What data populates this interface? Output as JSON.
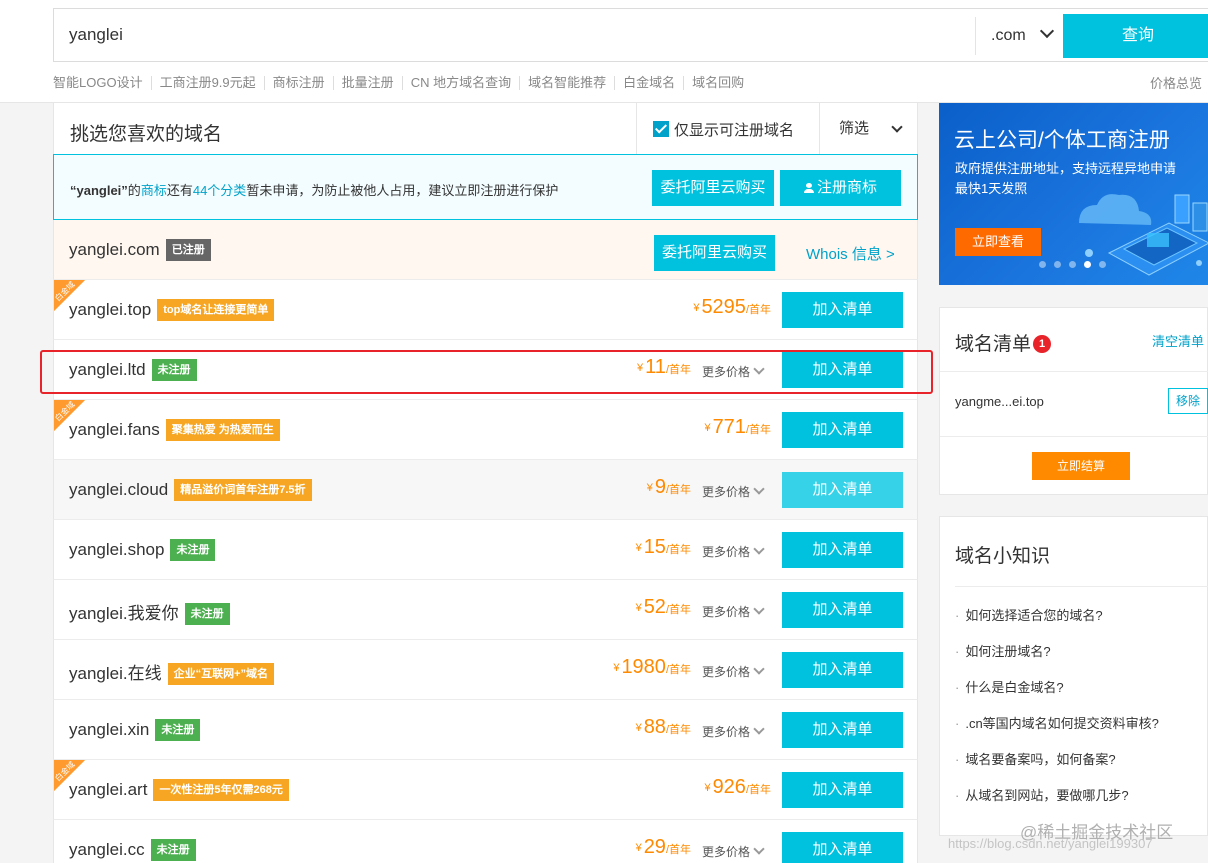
{
  "search": {
    "value": "yanglei",
    "suffix": ".com",
    "query_label": "查询"
  },
  "quick_links": [
    "智能LOGO设计",
    "工商注册9.9元起",
    "商标注册",
    "批量注册",
    "CN 地方域名查询",
    "域名智能推荐",
    "白金域名",
    "域名回购"
  ],
  "price_overview": "价格总览",
  "list": {
    "title": "挑选您喜欢的域名",
    "only_registrable": "仅显示可注册域名",
    "filter": "筛选"
  },
  "trademark": {
    "name": "“yanglei”",
    "t1": "的",
    "link1": "商标",
    "t2": "还有",
    "link2": "44个分类",
    "t3": "暂未申请，为防止被他人占用，建议立即注册进行保护",
    "buy_label": "委托阿里云购买",
    "register_label": "注册商标"
  },
  "registered_row": {
    "domain": "yanglei.com",
    "tag": "已注册",
    "buy_label": "委托阿里云购买",
    "whois_label": "Whois 信息 >"
  },
  "common": {
    "yen": "¥",
    "per_year": "/首年",
    "more_price": "更多价格",
    "add_label": "加入清单",
    "corner_label": "白金域"
  },
  "rows": [
    {
      "domain": "yanglei.top",
      "tag": "top域名让连接更简单",
      "price": "5295"
    },
    {
      "domain": "yanglei.ltd",
      "tag": "未注册",
      "price": "11"
    },
    {
      "domain": "yanglei.fans",
      "tag": "聚集热爱 为热爱而生",
      "price": "771"
    },
    {
      "domain": "yanglei.cloud",
      "tag": "精品溢价词首年注册7.5折",
      "price": "9"
    },
    {
      "domain": "yanglei.shop",
      "tag": "未注册",
      "price": "15"
    },
    {
      "domain": "yanglei.我爱你",
      "tag": "未注册",
      "price": "52"
    },
    {
      "domain": "yanglei.在线",
      "tag": "企业“互联网+”域名",
      "price": "1980"
    },
    {
      "domain": "yanglei.xin",
      "tag": "未注册",
      "price": "88"
    },
    {
      "domain": "yanglei.art",
      "tag": "一次性注册5年仅需268元",
      "price": "926"
    },
    {
      "domain": "yanglei.cc",
      "tag": "未注册",
      "price": "29"
    }
  ],
  "banner": {
    "title": "云上公司/个体工商注册",
    "sub1": "政府提供注册地址，支持远程异地申请",
    "sub2": "最快1天发照",
    "button": "立即查看"
  },
  "cart": {
    "title": "域名清单",
    "badge": "1",
    "clear": "清空清单",
    "item": "yangme...ei.top",
    "remove": "移除",
    "checkout": "立即结算"
  },
  "knowledge": {
    "title": "域名小知识",
    "items": [
      "如何选择适合您的域名?",
      "如何注册域名?",
      "什么是白金域名?",
      ".cn等国内域名如何提交资料审核?",
      "域名要备案吗，如何备案?",
      "从域名到网站，要做哪几步?"
    ]
  },
  "watermark": "@稀土掘金技术社区",
  "watermark_url": "https://blog.csdn.net/yanglei199307",
  "colors": {
    "accent": "#00c1de",
    "price": "#ff8a00",
    "highlight": "#e8232a"
  }
}
